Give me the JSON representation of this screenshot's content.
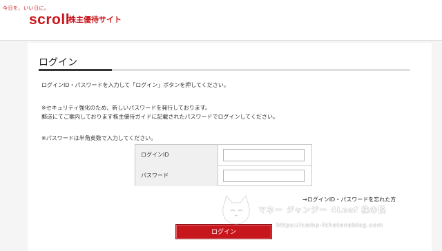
{
  "header": {
    "tagline": "今日を、いい日に。",
    "brand": "scroll",
    "subtitle": "株主優待サイト"
  },
  "page": {
    "title": "ログイン",
    "instruction": "ログインID・パスワードを入力して「ログイン」ボタンを押してください。",
    "security_note_1": "※セキュリティ強化のため、新しいパスワードを発行しております。",
    "security_note_2": "郵送にてご案内しております株主優待ガイドに記載されたパスワードでログインしてください。",
    "password_note": "※パスワードは半角英数で入力してください。"
  },
  "form": {
    "login_id_label": "ログインID",
    "login_id_value": "",
    "password_label": "パスワード",
    "password_value": ""
  },
  "links": {
    "forgot": "→ログインID・パスワードを忘れた方"
  },
  "buttons": {
    "login": "ログイン"
  },
  "watermark": {
    "text": "マネー ジャンジー 4Leaf 株の悦",
    "url": "https://camp-fchatenablog.com"
  },
  "colors": {
    "brand_red": "#c8161d",
    "background": "#f5f5f5"
  }
}
